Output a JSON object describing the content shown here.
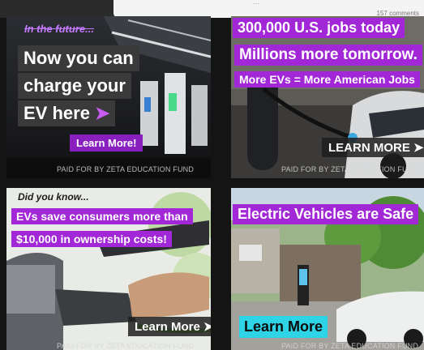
{
  "header": {
    "top_text": "...",
    "comments": "157 comments"
  },
  "ads": [
    {
      "eyebrow": "In the future...",
      "headline_lines": [
        "Now you can",
        "charge your",
        "EV here"
      ],
      "arrow": "➤",
      "cta": "Learn More!",
      "disclaimer": "PAID FOR BY ZETA EDUCATION FUND"
    },
    {
      "headline_lines": [
        "300,000 U.S. jobs today",
        "Millions more tomorrow."
      ],
      "subline": "More EVs = More American Jobs",
      "cta": "LEARN MORE ➤",
      "disclaimer": "PAID FOR BY ZETA EDUCATION FUND"
    },
    {
      "eyebrow": "Did you know...",
      "headline_lines": [
        "EVs save consumers more than",
        "$10,000 in ownership costs!"
      ],
      "cta": "Learn More ➤",
      "disclaimer": "PAID FOR BY ZETA EDUCATION FUND"
    },
    {
      "headline_lines": [
        "Electric Vehicles are Safe"
      ],
      "cta": "Learn More",
      "disclaimer": "PAID FOR BY ZETA EDUCATION FUND"
    }
  ],
  "colors": {
    "purple": "#a227d6",
    "cyan_button": "#2ed4e6",
    "page_bg": "#141414"
  }
}
